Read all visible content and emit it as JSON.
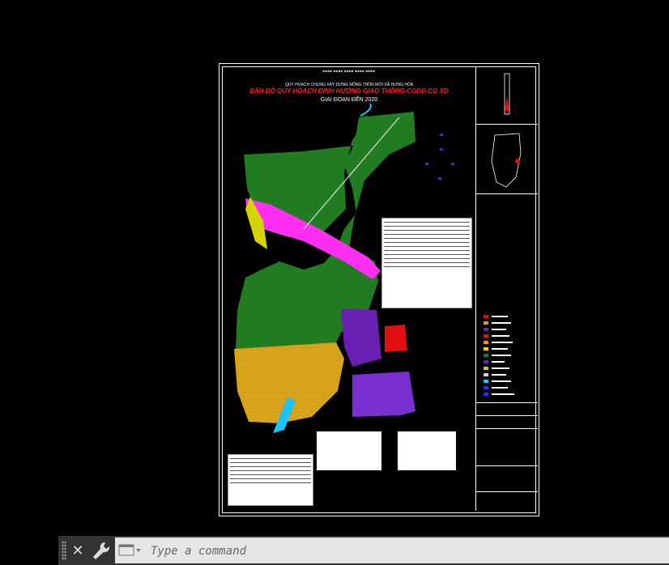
{
  "drawing": {
    "header_sup": "■■■■ ■■■■ ■■■■ ■■■■ ■■■■",
    "title_line1": "QUY HOẠCH CHUNG XÂY DỰNG NÔNG THÔN MỚI XÃ HƯNG HÒA",
    "title_line2": "BẢN ĐỒ QUY HOẠCH ĐỊNH HƯỚNG GIAO THÔNG-CGĐĐ-CG XD",
    "title_line3": "GIAI ĐOẠN ĐẾN 2020"
  },
  "colors": {
    "background": "#000000",
    "agri_green": "#1f7a1f",
    "residential_yellow": "#d4a017",
    "road_magenta": "#ff2ef0",
    "industrial_purple": "#6a1fb3",
    "red_zone": "#e01010",
    "water_cyan": "#19c4ff"
  },
  "command_line": {
    "placeholder": "Type a command"
  }
}
